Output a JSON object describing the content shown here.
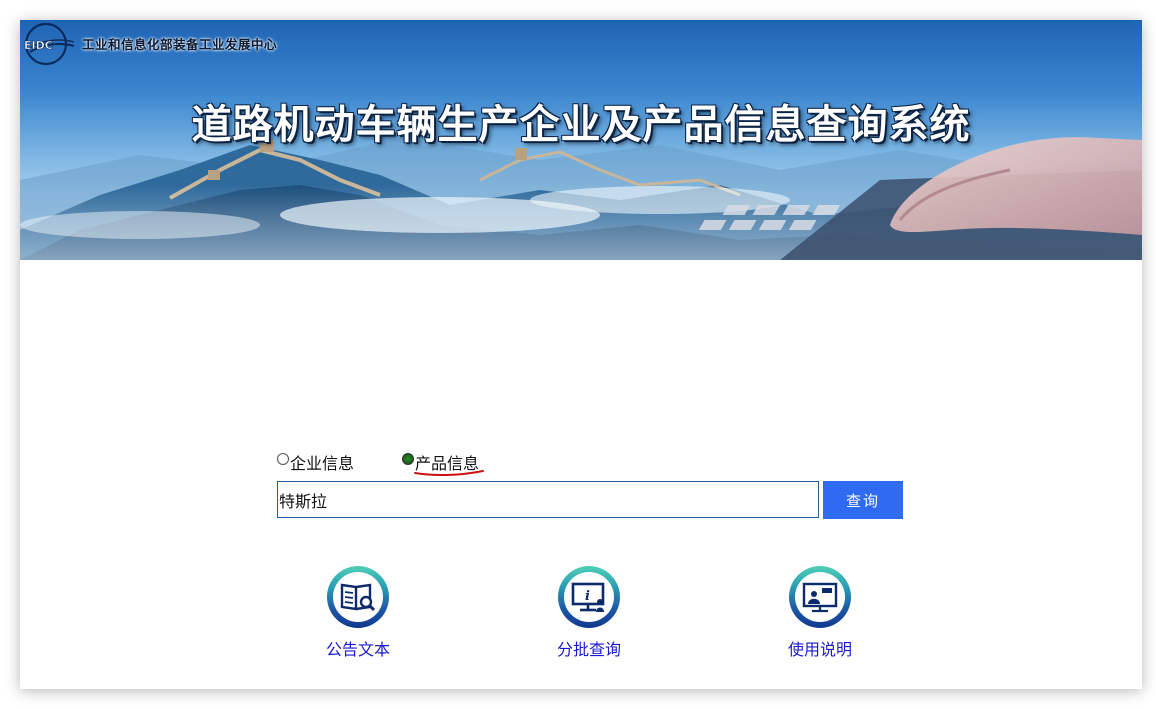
{
  "header": {
    "logo_text": "EIDC",
    "org_name": "工业和信息化部装备工业发展中心",
    "system_title": "道路机动车辆生产企业及产品信息查询系统"
  },
  "query_type": {
    "options": [
      {
        "label": "企业信息",
        "selected": false
      },
      {
        "label": "产品信息",
        "selected": true
      }
    ]
  },
  "search": {
    "value": "特斯拉",
    "button_label": "查询"
  },
  "nav": {
    "items": [
      {
        "label": "公告文本",
        "icon": "book-search-icon"
      },
      {
        "label": "分批查询",
        "icon": "monitor-info-icon"
      },
      {
        "label": "使用说明",
        "icon": "screen-presenter-icon"
      }
    ]
  },
  "colors": {
    "accent_button": "#2f6bf2",
    "link_text": "#1a1acc",
    "banner_blue": "#1f64b4",
    "annotation_red": "#cc1111"
  }
}
